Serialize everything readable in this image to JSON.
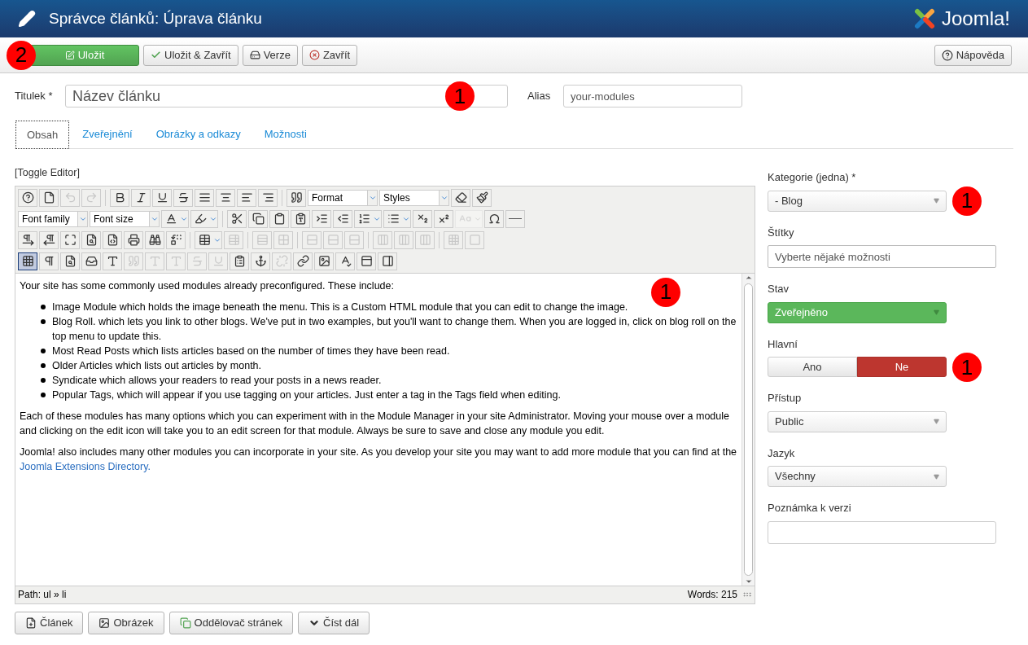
{
  "header": {
    "title": "Správce článků: Úprava článku",
    "logo_text": "Joomla!"
  },
  "toolbar": {
    "buttons": [
      {
        "label": "Uložit",
        "kind": "primary",
        "marker": "2"
      },
      {
        "label": "Uložit & Zavřít",
        "kind": "check"
      },
      {
        "label": "Verze",
        "kind": "versions"
      },
      {
        "label": "Zavřít",
        "kind": "close"
      }
    ],
    "help": "Nápověda"
  },
  "title_field": {
    "label": "Titulek *",
    "value": "Název článku",
    "marker": "1"
  },
  "alias_field": {
    "label": "Alias",
    "value": "your-modules"
  },
  "tabs": [
    {
      "label": "Obsah",
      "selected": true
    },
    {
      "label": "Zveřejnění",
      "selected": false
    },
    {
      "label": "Obrázky a odkazy",
      "selected": false
    },
    {
      "label": "Možnosti",
      "selected": false
    }
  ],
  "editor": {
    "toggle": "[Toggle Editor]",
    "marker": "1",
    "toolbar_rows": [
      [
        {
          "kind": "button",
          "disabled": false,
          "pressed": false
        },
        {
          "kind": "button",
          "disabled": false,
          "pressed": false
        },
        {
          "kind": "button",
          "disabled": true,
          "pressed": false
        },
        {
          "kind": "button",
          "disabled": true,
          "pressed": false
        },
        {
          "kind": "separator"
        },
        {
          "kind": "button",
          "disabled": false,
          "pressed": false
        },
        {
          "kind": "button",
          "disabled": false,
          "pressed": false
        },
        {
          "kind": "button",
          "disabled": false,
          "pressed": false
        },
        {
          "kind": "button",
          "disabled": false,
          "pressed": false
        },
        {
          "kind": "button",
          "disabled": false,
          "pressed": false
        },
        {
          "kind": "button",
          "disabled": false,
          "pressed": false
        },
        {
          "kind": "button",
          "disabled": false,
          "pressed": false
        },
        {
          "kind": "button",
          "disabled": false,
          "pressed": false
        },
        {
          "kind": "separator"
        },
        {
          "kind": "button",
          "disabled": false,
          "pressed": false
        },
        {
          "kind": "dropdown",
          "label": "Format"
        },
        {
          "kind": "dropdown",
          "label": "Styles"
        },
        {
          "kind": "button",
          "disabled": false,
          "pressed": false
        },
        {
          "kind": "button",
          "disabled": false,
          "pressed": false
        }
      ],
      [
        {
          "kind": "dropdown",
          "label": "Font family"
        },
        {
          "kind": "dropdown",
          "label": "Font size"
        },
        {
          "kind": "split",
          "disabled": false
        },
        {
          "kind": "split",
          "disabled": false
        },
        {
          "kind": "separator"
        },
        {
          "kind": "button",
          "disabled": false,
          "pressed": false
        },
        {
          "kind": "button",
          "disabled": false,
          "pressed": false
        },
        {
          "kind": "button",
          "disabled": false,
          "pressed": false
        },
        {
          "kind": "button",
          "disabled": false,
          "pressed": false
        },
        {
          "kind": "button",
          "disabled": false,
          "pressed": false
        },
        {
          "kind": "button",
          "disabled": false,
          "pressed": false
        },
        {
          "kind": "split",
          "disabled": false
        },
        {
          "kind": "split",
          "disabled": false
        },
        {
          "kind": "button",
          "disabled": false,
          "pressed": false
        },
        {
          "kind": "button",
          "disabled": false,
          "pressed": false
        },
        {
          "kind": "split",
          "disabled": true
        },
        {
          "kind": "button",
          "disabled": false,
          "pressed": false
        },
        {
          "kind": "button",
          "disabled": false,
          "pressed": false
        }
      ],
      [
        {
          "kind": "button",
          "disabled": false,
          "pressed": false
        },
        {
          "kind": "button",
          "disabled": false,
          "pressed": false
        },
        {
          "kind": "button",
          "disabled": false,
          "pressed": false
        },
        {
          "kind": "button",
          "disabled": false,
          "pressed": false
        },
        {
          "kind": "button",
          "disabled": false,
          "pressed": false
        },
        {
          "kind": "button",
          "disabled": false,
          "pressed": false
        },
        {
          "kind": "button",
          "disabled": false,
          "pressed": false
        },
        {
          "kind": "button",
          "disabled": false,
          "pressed": false
        },
        {
          "kind": "separator"
        },
        {
          "kind": "split",
          "disabled": false
        },
        {
          "kind": "button",
          "disabled": true,
          "pressed": false
        },
        {
          "kind": "separator"
        },
        {
          "kind": "button",
          "disabled": true,
          "pressed": false
        },
        {
          "kind": "button",
          "disabled": true,
          "pressed": false
        },
        {
          "kind": "separator"
        },
        {
          "kind": "button",
          "disabled": true,
          "pressed": false
        },
        {
          "kind": "button",
          "disabled": true,
          "pressed": false
        },
        {
          "kind": "button",
          "disabled": true,
          "pressed": false
        },
        {
          "kind": "separator"
        },
        {
          "kind": "button",
          "disabled": true,
          "pressed": false
        },
        {
          "kind": "button",
          "disabled": true,
          "pressed": false
        },
        {
          "kind": "button",
          "disabled": true,
          "pressed": false
        },
        {
          "kind": "separator"
        },
        {
          "kind": "button",
          "disabled": true,
          "pressed": false
        },
        {
          "kind": "button",
          "disabled": true,
          "pressed": false
        }
      ],
      [
        {
          "kind": "button",
          "disabled": false,
          "pressed": true
        },
        {
          "kind": "button",
          "disabled": false,
          "pressed": false
        },
        {
          "kind": "button",
          "disabled": false,
          "pressed": false
        },
        {
          "kind": "button",
          "disabled": false,
          "pressed": false
        },
        {
          "kind": "button",
          "disabled": false,
          "pressed": false
        },
        {
          "kind": "button",
          "disabled": true,
          "pressed": false
        },
        {
          "kind": "button",
          "disabled": true,
          "pressed": false
        },
        {
          "kind": "button",
          "disabled": true,
          "pressed": false
        },
        {
          "kind": "button",
          "disabled": true,
          "pressed": false
        },
        {
          "kind": "button",
          "disabled": true,
          "pressed": false
        },
        {
          "kind": "button",
          "disabled": false,
          "pressed": false
        },
        {
          "kind": "button",
          "disabled": false,
          "pressed": false
        },
        {
          "kind": "button",
          "disabled": true,
          "pressed": false
        },
        {
          "kind": "button",
          "disabled": false,
          "pressed": false
        },
        {
          "kind": "button",
          "disabled": false,
          "pressed": false
        },
        {
          "kind": "button",
          "disabled": false,
          "pressed": false
        },
        {
          "kind": "button",
          "disabled": false,
          "pressed": false
        },
        {
          "kind": "button",
          "disabled": false,
          "pressed": false
        }
      ]
    ],
    "content": [
      {
        "kind": "paragraph",
        "text": "Your site has some commonly used modules already preconfigured. These include:"
      },
      {
        "kind": "list",
        "items": [
          "Image Module which holds the image beneath the menu. This is a Custom HTML module that you can edit to change the image.",
          "Blog Roll. which lets you link to other blogs. We've put in two examples, but you'll want to change them. When you are logged in, click on blog roll on the top menu to update this.",
          "Most Read Posts which lists articles based on the number of times they have been read.",
          "Older Articles which lists out articles by month.",
          "Syndicate which allows your readers to read your posts in a news reader.",
          "Popular Tags, which will appear if you use tagging on your articles. Just enter a tag in the Tags field when editing."
        ]
      },
      {
        "kind": "paragraph",
        "text": "Each of these modules has many options which you can experiment with in the Module Manager in your site Administrator. Moving your mouse over a module and clicking on the edit icon will take you to an edit screen for that module. Always be sure to save and close any module you edit."
      },
      {
        "kind": "paragraph",
        "text": "Joomla! also includes many other modules you can incorporate in your site. As you develop your site you may want to add more module that you can find at the ",
        "link": "Joomla Extensions Directory."
      }
    ],
    "path": "Path: ul » li",
    "words": "Words: 215"
  },
  "insert_buttons": [
    {
      "label": "Článek",
      "kind": "article"
    },
    {
      "label": "Obrázek",
      "kind": "image"
    },
    {
      "label": "Oddělovač stránek",
      "kind": "pagebreak"
    },
    {
      "label": "Číst dál",
      "kind": "readmore"
    }
  ],
  "sidebar": {
    "fields": [
      {
        "kind": "select",
        "label": "Kategorie (jedna) *",
        "value": "- Blog",
        "marker": "1"
      },
      {
        "kind": "tags",
        "label": "Štítky",
        "placeholder": "Vyberte nějaké možnosti"
      },
      {
        "kind": "status",
        "label": "Stav",
        "value": "Zveřejněno"
      },
      {
        "kind": "toggle",
        "label": "Hlavní",
        "options": [
          {
            "label": "Ano",
            "selected": false
          },
          {
            "label": "Ne",
            "selected": true
          }
        ],
        "marker": "1"
      },
      {
        "kind": "select",
        "label": "Přístup",
        "value": "Public"
      },
      {
        "kind": "select",
        "label": "Jazyk",
        "value": "Všechny"
      },
      {
        "kind": "text",
        "label": "Poznámka k verzi"
      }
    ]
  }
}
